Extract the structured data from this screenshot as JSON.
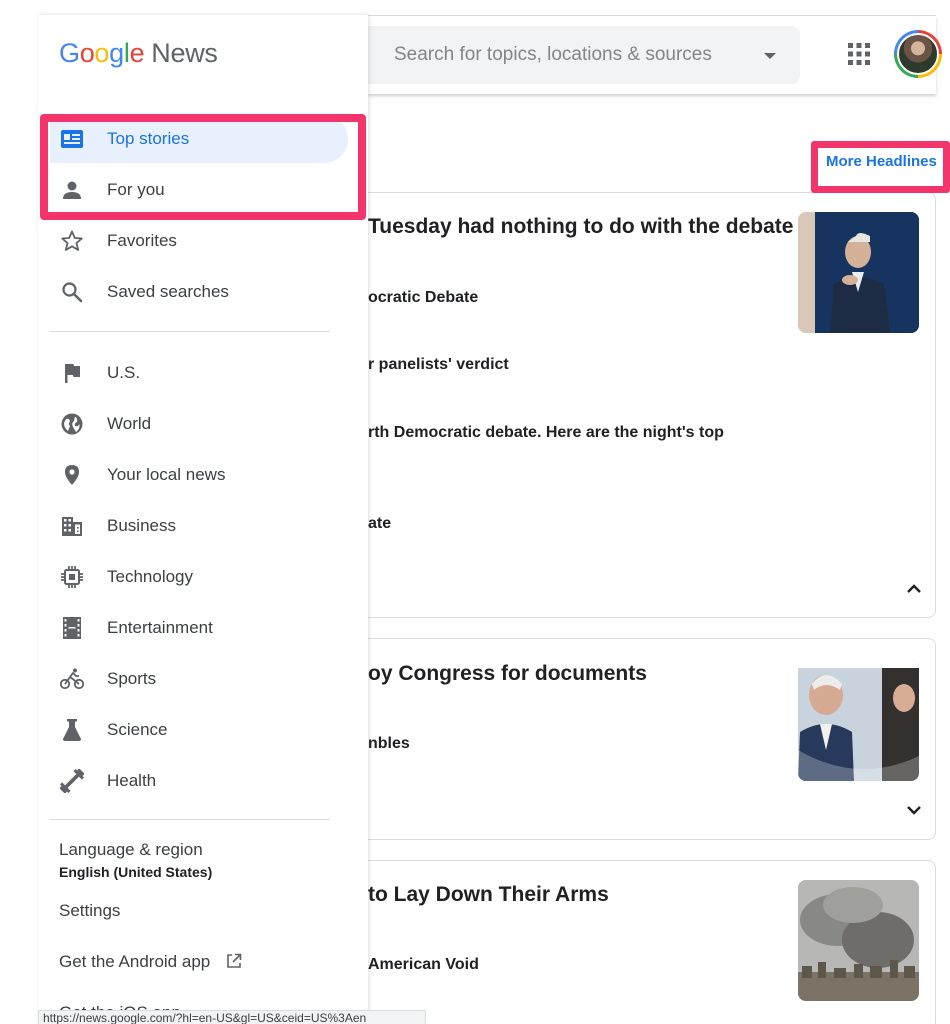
{
  "header": {
    "search_placeholder": "Search for topics, locations & sources"
  },
  "logo": {
    "google": "Google",
    "news": "News"
  },
  "sidebar": {
    "primary": [
      {
        "label": "Top stories",
        "icon": "top-stories-icon",
        "active": true
      },
      {
        "label": "For you",
        "icon": "person-icon"
      },
      {
        "label": "Favorites",
        "icon": "star-icon"
      },
      {
        "label": "Saved searches",
        "icon": "search-icon"
      }
    ],
    "sections": [
      {
        "label": "U.S.",
        "icon": "flag-icon"
      },
      {
        "label": "World",
        "icon": "globe-icon"
      },
      {
        "label": "Your local news",
        "icon": "location-pin-icon"
      },
      {
        "label": "Business",
        "icon": "building-icon"
      },
      {
        "label": "Technology",
        "icon": "chip-icon"
      },
      {
        "label": "Entertainment",
        "icon": "film-icon"
      },
      {
        "label": "Sports",
        "icon": "bike-icon"
      },
      {
        "label": "Science",
        "icon": "flask-icon"
      },
      {
        "label": "Health",
        "icon": "dumbbell-icon"
      }
    ],
    "language_label": "Language & region",
    "language_value": "English (United States)",
    "settings": "Settings",
    "android_app": "Get the Android app",
    "ios_app": "Get the iOS app"
  },
  "main": {
    "more_headlines": "More Headlines",
    "story1": {
      "headline": "Tuesday had nothing to do with the debate",
      "subs": [
        "ocratic Debate",
        "r panelists' verdict",
        "rth Democratic debate. Here are the night's top",
        "ate"
      ]
    },
    "story2": {
      "headline": "oy Congress for documents",
      "subs": [
        "nbles"
      ]
    },
    "story3": {
      "headline": "to Lay Down Their Arms",
      "subs": [
        "American Void"
      ]
    }
  },
  "status_bar": {
    "url": "https://news.google.com/?hl=en-US&gl=US&ceid=US%3Aen"
  },
  "colors": {
    "accent": "#1a73e8",
    "active_bg": "#e8f0fe",
    "annotation": "#f4356c"
  }
}
